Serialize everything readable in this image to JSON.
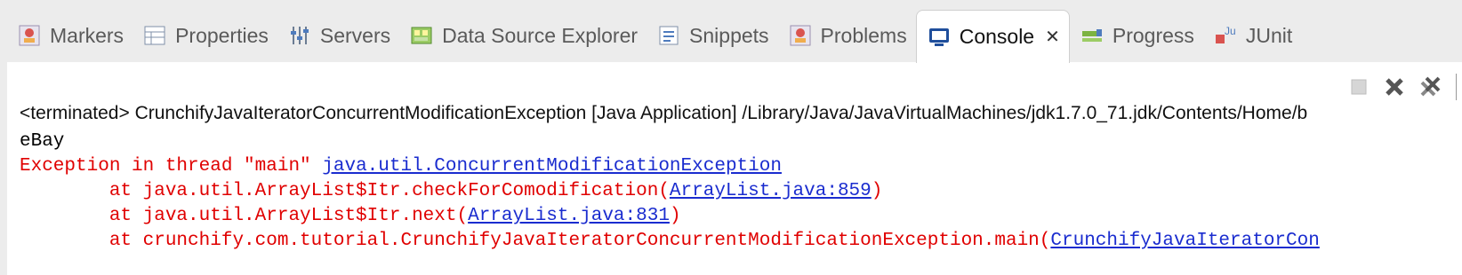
{
  "tabs": [
    {
      "label": "Markers",
      "icon": "markers-icon"
    },
    {
      "label": "Properties",
      "icon": "properties-icon"
    },
    {
      "label": "Servers",
      "icon": "servers-icon"
    },
    {
      "label": "Data Source Explorer",
      "icon": "data-source-icon"
    },
    {
      "label": "Snippets",
      "icon": "snippets-icon"
    },
    {
      "label": "Problems",
      "icon": "problems-icon"
    },
    {
      "label": "Console",
      "icon": "console-icon",
      "active": true
    },
    {
      "label": "Progress",
      "icon": "progress-icon"
    },
    {
      "label": "JUnit",
      "icon": "junit-icon"
    }
  ],
  "console_tab_close": "✕",
  "toolbar": {
    "terminate_icon": "terminate-icon",
    "remove_launch_icon": "remove-launch-icon",
    "remove_all_icon": "remove-all-terminated-icon"
  },
  "status_line": "<terminated> CrunchifyJavaIteratorConcurrentModificationException [Java Application] /Library/Java/JavaVirtualMachines/jdk1.7.0_71.jdk/Contents/Home/b",
  "output": {
    "line1": "eBay",
    "exc_prefix": "Exception in thread \"main\" ",
    "exc_link": "java.util.ConcurrentModificationException",
    "f1_prefix": "        at java.util.ArrayList$Itr.checkForComodification(",
    "f1_link": "ArrayList.java:859",
    "f1_suffix": ")",
    "f2_prefix": "        at java.util.ArrayList$Itr.next(",
    "f2_link": "ArrayList.java:831",
    "f2_suffix": ")",
    "f3_prefix": "        at crunchify.com.tutorial.CrunchifyJavaIteratorConcurrentModificationException.main(",
    "f3_link": "CrunchifyJavaIteratorCon"
  }
}
